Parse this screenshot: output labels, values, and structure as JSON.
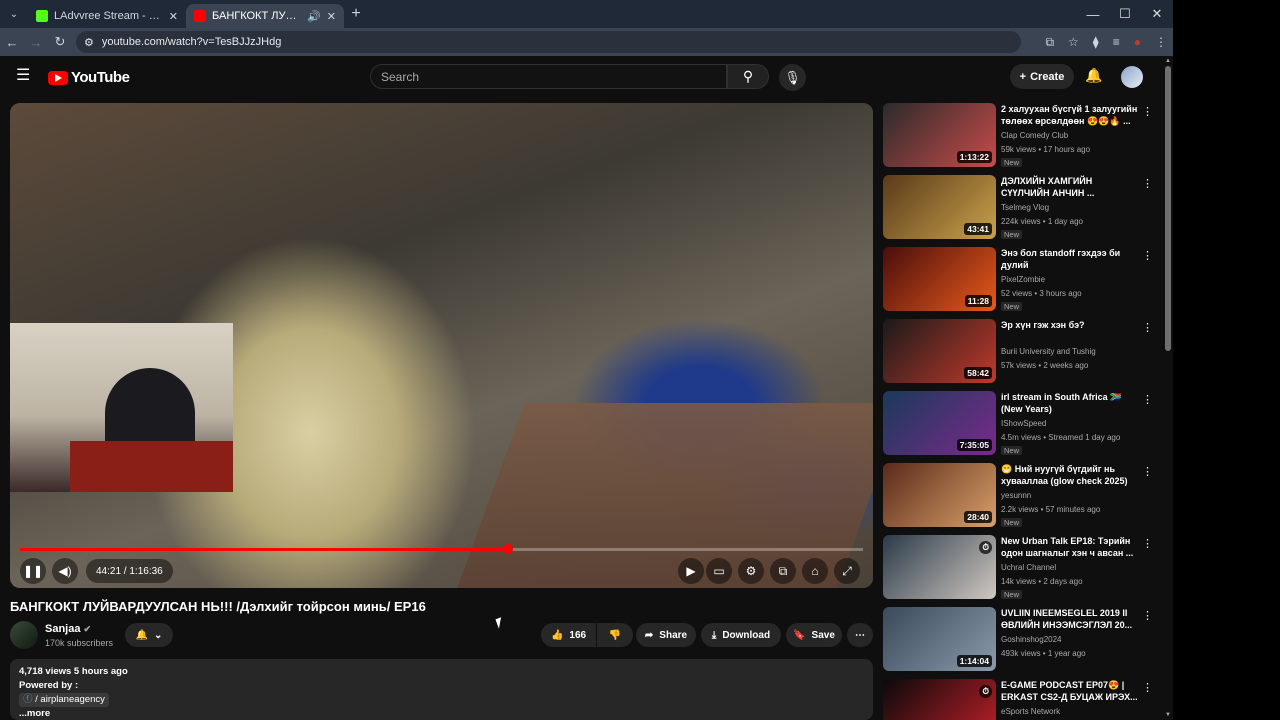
{
  "browser": {
    "tabs": [
      {
        "title": "LAdvvree Stream - Watch Live o",
        "favicon_color": "#53fc18"
      },
      {
        "title": "БАНГКОКТ ЛУЙВАРДУУЛС",
        "favicon_color": "#ff0000"
      }
    ],
    "url": "youtube.com/watch?v=TesBJJzJHdg"
  },
  "masthead": {
    "logo_text": "YouTube",
    "search_placeholder": "Search",
    "create_label": "Create"
  },
  "player": {
    "current_time": "44:21",
    "duration": "1:16:36",
    "time_display": "44:21 / 1:16:36",
    "progress_fraction": 0.579
  },
  "video": {
    "title": "БАНГКОКТ ЛУЙВАРДУУЛСАН НЬ!!! /Дэлхийг тойрсон минь/ EP16",
    "channel": "Sanjaa",
    "subscribers": "170k subscribers",
    "likes": "166",
    "share_label": "Share",
    "download_label": "Download",
    "save_label": "Save"
  },
  "description": {
    "views_date": "4,718 views  5 hours ago",
    "powered_by": "Powered by :",
    "tag": "/ airplaneagency",
    "more": "...more"
  },
  "sidebar": [
    {
      "title": "2 халуухан бүсгүй 1 залуугийн төлөөх өрсөлдөөн 😍😍🔥 ...",
      "channel": "Clap Comedy Club",
      "meta": "59k views • 17 hours ago",
      "badge": "New",
      "duration": "1:13:22",
      "colors": [
        "#2b2b2b",
        "#c94a4a"
      ]
    },
    {
      "title": "ДЭЛХИЙН ХАМГИЙН СҮҮЛЧИЙН АНЧИН ...",
      "channel": "Tselmeg Vlog",
      "meta": "224k views • 1 day ago",
      "badge": "New",
      "duration": "43:41",
      "colors": [
        "#5a3a1a",
        "#c9a24a"
      ]
    },
    {
      "title": "Энэ бол standoff гэхдээ би дулий",
      "channel": "PixelZombie",
      "meta": "52 views • 3 hours ago",
      "badge": "New",
      "duration": "11:28",
      "colors": [
        "#4a0d0d",
        "#e85a1a"
      ]
    },
    {
      "title": "Эр хүн гэж хэн бэ?",
      "channel": "Burii University",
      "channel_extra": "and Tushig",
      "meta": "57k views • 2 weeks ago",
      "badge": "",
      "duration": "58:42",
      "colors": [
        "#1a1a1a",
        "#c0392b"
      ]
    },
    {
      "title": "irl stream in South Africa 🇿🇦 (New Years)",
      "channel": "IShowSpeed",
      "meta": "4.5m views • Streamed 1 day ago",
      "badge": "New",
      "duration": "7:35:05",
      "colors": [
        "#1a3a5a",
        "#7a2a8a"
      ]
    },
    {
      "title": "😁 Ний нуугүй бүгдийг нь хувааллаа (glow check 2025)",
      "channel": "yesunnn",
      "meta": "2.2k views • 57 minutes ago",
      "badge": "New",
      "duration": "28:40",
      "colors": [
        "#5a2a1a",
        "#d9a06a"
      ]
    },
    {
      "title": "New Urban Talk EP18: Тэрийн одон шагналыг хэн ч авсан ...",
      "channel": "Uchral Channel",
      "meta": "14k views • 2 days ago",
      "badge": "New",
      "duration": "",
      "colors": [
        "#2a3a4a",
        "#d0c8c0"
      ]
    },
    {
      "title": "UVLIIN INEEMSEGLEL 2019 II ӨВЛИЙН ИНЭЭМСЭГЛЭЛ 20...",
      "channel": "Goshinshog2024",
      "meta": "493k views • 1 year ago",
      "badge": "",
      "duration": "1:14:04",
      "colors": [
        "#3a4a5a",
        "#8a9aaa"
      ]
    },
    {
      "title": "E-GAME PODCAST EP07😍 | ERKAST CS2-Д БУЦАЖ ИРЭХ...",
      "channel": "eSports Network",
      "meta": "",
      "badge": "",
      "duration": "",
      "colors": [
        "#0a0a0a",
        "#c0202a"
      ]
    }
  ]
}
